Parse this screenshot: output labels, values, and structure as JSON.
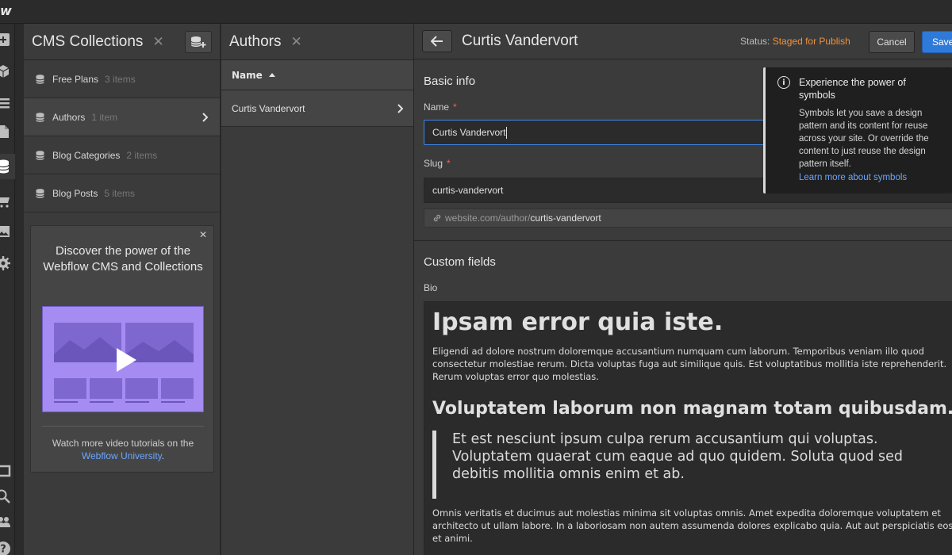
{
  "app": {
    "logo": "w"
  },
  "collections_panel": {
    "title": "CMS Collections",
    "items": [
      {
        "name": "Free Plans",
        "count": "3 items"
      },
      {
        "name": "Authors",
        "count": "1 item"
      },
      {
        "name": "Blog Categories",
        "count": "2 items"
      },
      {
        "name": "Blog Posts",
        "count": "5 items"
      }
    ],
    "promo": {
      "title": "Discover the power of the Webflow CMS and Collections",
      "footer_text": "Watch more video tutorials on the",
      "footer_link": "Webflow University",
      "footer_end": "."
    }
  },
  "authors_panel": {
    "title": "Authors",
    "column_header": "Name",
    "rows": [
      "Curtis Vandervort"
    ]
  },
  "editor": {
    "title": "Curtis Vandervort",
    "status_label": "Status:",
    "status_value": "Staged for Publish",
    "cancel_label": "Cancel",
    "save_label": "Save",
    "basic_info_title": "Basic info",
    "name_label": "Name",
    "name_value": "Curtis Vandervort",
    "slug_label": "Slug",
    "slug_value": "curtis-vandervort",
    "url_prefix": "website.com/author/",
    "url_slug": "curtis-vandervort",
    "custom_fields_title": "Custom fields",
    "bio_label": "Bio",
    "bio": {
      "h1": "Ipsam error quia iste.",
      "p1": "Eligendi ad dolore nostrum doloremque accusantium numquam cum laborum. Temporibus veniam illo quod consectetur molestiae rerum. Dicta voluptas fuga aut similique quis. Est voluptatibus mollitia iste reprehenderit. Rerum voluptas error quo molestias.",
      "h2": "Voluptatem laborum non magnam totam quibusdam.",
      "quote": "Et est nesciunt ipsum culpa rerum accusantium qui voluptas. Voluptatem quaerat cum eaque ad quo quidem. Soluta quod sed debitis mollitia omnis enim et ab.",
      "p2": "Omnis veritatis et ducimus aut molestias minima sit voluptas omnis. Amet expedita doloremque voluptatem et architecto ut ullam labore. In a laboriosam non autem assumenda dolores explicabo quia. Aut aut perspiciatis eos et animi."
    }
  },
  "tooltip": {
    "title": "Experience the power of symbols",
    "body": "Symbols let you save a design pattern and its content for reuse across your site. Or override the content to just reuse the design pattern itself.",
    "link": "Learn more about symbols"
  },
  "colors": {
    "accent": "#2f7ad8",
    "status": "#f0923b",
    "required": "#ff5a5a",
    "link": "#6aa6ff",
    "promo_thumb": "#a48cf2"
  }
}
